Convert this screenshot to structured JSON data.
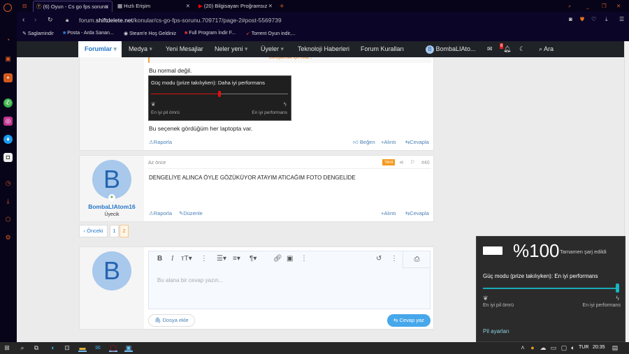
{
  "browser": {
    "tabs": [
      {
        "label": "(6) Oyun - Cs go fps sorunu"
      },
      {
        "label": "Hızlı Erişim"
      },
      {
        "label": "(20) Bilgisayarı Proğramsız"
      }
    ],
    "url_prefix": "forum.",
    "url_domain": "shiftdelete.net",
    "url_path": "/konular/cs-go-fps-sorunu.709717/page-2#post-5569739",
    "bookmarks": [
      "Saglamindir",
      "Posta - Arda Sanan...",
      "Steam'e Hoş Geldiniz",
      "Full Program İndir F...",
      "Torrent Oyun indir,..."
    ]
  },
  "nav": {
    "items": [
      "Forumlar",
      "Medya",
      "Yeni Mesajlar",
      "Neler yeni",
      "Üyeler",
      "Teknoloji Haberleri",
      "Forum Kuralları"
    ],
    "user": "BombaLIAto...",
    "user_initial": "B",
    "alerts": "6",
    "search": "Ara"
  },
  "post1": {
    "quote_more": "Genişletmek için tıkla...",
    "text1": "Bu normal değil.",
    "image": {
      "title": "Güç modu (prize takılıyken): Daha iyi performans",
      "slider_value": 0.5,
      "left": "En iyi pil ömrü",
      "right": "En iyi performans"
    },
    "text2": "Bu seçenek gördüğüm her laptopta var.",
    "report": "Raporla",
    "like": "Beğen",
    "quote": "Alıntı",
    "reply": "Cevapla"
  },
  "post2": {
    "time": "Az önce",
    "badge": "Yeni",
    "number": "#40",
    "text": "DENGELİYE ALINCA ÖYLE GÖZÜKÜYOR ATAYIM ATICAĞIM FOTO DENGELİDE",
    "user": "BombaLIAtom16",
    "role": "Üyecik",
    "initial": "B",
    "report": "Raporla",
    "edit": "Düzenle",
    "quote": "Alıntı",
    "reply": "Cevapla"
  },
  "pagination": {
    "prev": "Önceki",
    "pages": [
      "1",
      "2"
    ],
    "current": "2"
  },
  "editor": {
    "placeholder": "Bu alana bir cevap yazın...",
    "attach": "Dosya ekle",
    "submit": "Cevap yaz",
    "initial": "B"
  },
  "battery": {
    "percent": "%100",
    "status": "Tamamen şarj edildi",
    "mode": "Güç modu (prize takılıyken): En iyi performans",
    "slider_value": 1.0,
    "left": "En iyi pil ömrü",
    "right": "En iyi performans",
    "settings": "Pil ayarları"
  },
  "taskbar": {
    "lang": "TUR",
    "time": "20:35"
  }
}
